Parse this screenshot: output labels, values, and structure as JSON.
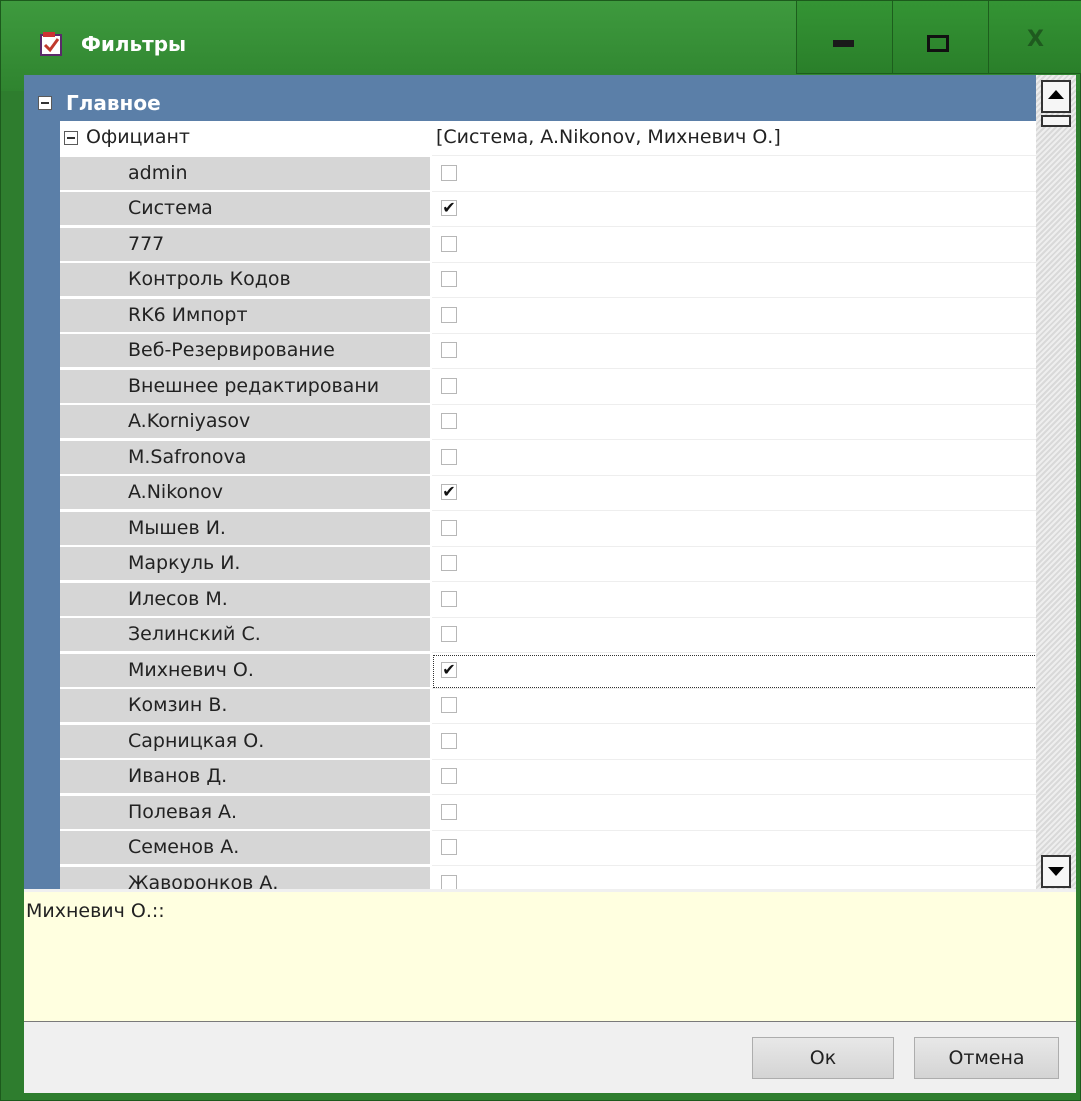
{
  "window": {
    "title": "Фильтры",
    "close_label": "X"
  },
  "category": {
    "label": "Главное"
  },
  "property": {
    "label": "Официант",
    "value": "[Система, A.Nikonov, Михневич О.]"
  },
  "items": [
    {
      "label": "admin",
      "checked": false
    },
    {
      "label": "Система",
      "checked": true
    },
    {
      "label": "777",
      "checked": false
    },
    {
      "label": "Контроль Кодов",
      "checked": false
    },
    {
      "label": "RK6 Импорт",
      "checked": false
    },
    {
      "label": "Веб-Резервирование",
      "checked": false
    },
    {
      "label": "Внешнее редактировани",
      "checked": false
    },
    {
      "label": "A.Korniyasov",
      "checked": false
    },
    {
      "label": "M.Safronova",
      "checked": false
    },
    {
      "label": "A.Nikonov",
      "checked": true
    },
    {
      "label": "Мышев И.",
      "checked": false
    },
    {
      "label": "Маркуль И.",
      "checked": false
    },
    {
      "label": "Илесов М.",
      "checked": false
    },
    {
      "label": "Зелинский С.",
      "checked": false
    },
    {
      "label": "Михневич О.",
      "checked": true,
      "focused": true
    },
    {
      "label": "Комзин В.",
      "checked": false
    },
    {
      "label": "Сарницкая О.",
      "checked": false
    },
    {
      "label": "Иванов Д.",
      "checked": false
    },
    {
      "label": "Полевая А.",
      "checked": false
    },
    {
      "label": "Семенов А.",
      "checked": false
    },
    {
      "label": "Жаворонков А.",
      "checked": false
    }
  ],
  "description": {
    "text": "Михневич О.::"
  },
  "footer": {
    "ok_label": "Ок",
    "cancel_label": "Отмена"
  },
  "colors": {
    "window_frame": "#2e7d2e",
    "category_bar": "#5b7fa8",
    "description_bg": "#ffffe0"
  }
}
